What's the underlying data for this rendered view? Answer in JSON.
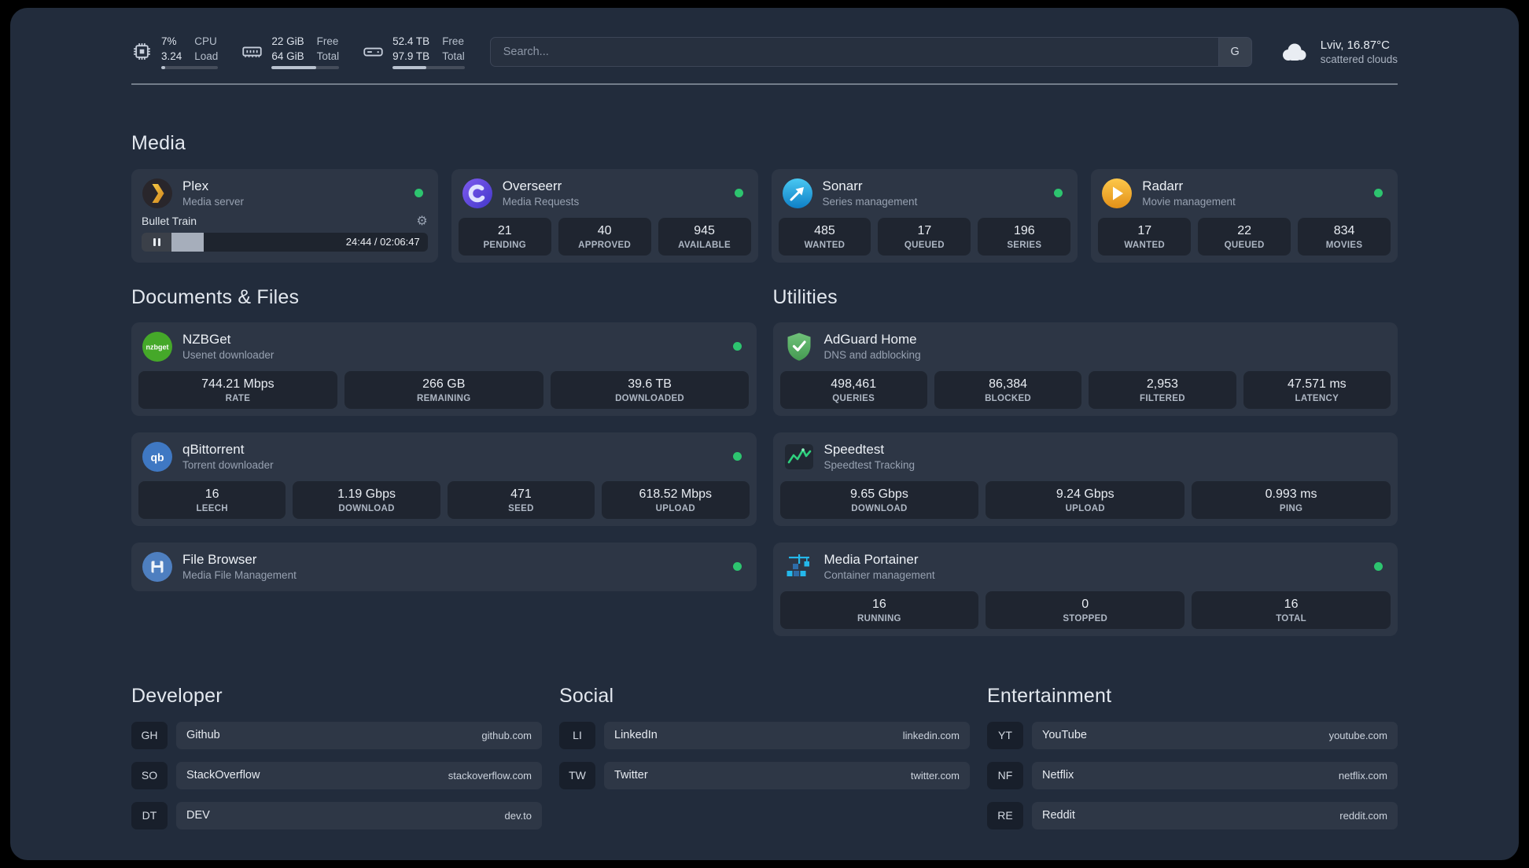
{
  "colors": {
    "status_online": "#2dc46f",
    "plex_gold": "#e5a00d",
    "overseerr_purple": "#6d4aef",
    "sonarr_blue": "#35c5f4",
    "radarr_amber": "#f7b731",
    "nzbget_green": "#45a829",
    "qbittorrent_blue": "#3f78c3",
    "filebrowser_blue": "#4e7fc0",
    "adguard_green": "#5bb462",
    "speedtest_green": "#2fd07e",
    "portainer_blue": "#24b8eb"
  },
  "icons": {
    "nzbget_text": "nzbget",
    "qbittorrent_text": "qb"
  },
  "topbar": {
    "resources": [
      {
        "value": "7%",
        "value2": "3.24",
        "label": "CPU",
        "label2": "Load",
        "progress_pct": 7
      },
      {
        "value": "22 GiB",
        "value2": "64 GiB",
        "label": "Free",
        "label2": "Total",
        "progress_pct": 66
      },
      {
        "value": "52.4 TB",
        "value2": "97.9 TB",
        "label": "Free",
        "label2": "Total",
        "progress_pct": 47
      }
    ],
    "search": {
      "placeholder": "Search...",
      "button": "G"
    },
    "weather": {
      "location": "Lviv, 16.87°C",
      "condition": "scattered clouds"
    }
  },
  "media": {
    "title": "Media",
    "plex": {
      "name": "Plex",
      "subtitle": "Media server",
      "player": {
        "title": "Bullet Train",
        "time": "24:44 / 02:06:47",
        "progress_pct": 19.5,
        "gear": "⚙"
      }
    },
    "overseerr": {
      "name": "Overseerr",
      "subtitle": "Media Requests",
      "stats": [
        {
          "value": "21",
          "label": "PENDING"
        },
        {
          "value": "40",
          "label": "APPROVED"
        },
        {
          "value": "945",
          "label": "AVAILABLE"
        }
      ]
    },
    "sonarr": {
      "name": "Sonarr",
      "subtitle": "Series management",
      "stats": [
        {
          "value": "485",
          "label": "WANTED"
        },
        {
          "value": "17",
          "label": "QUEUED"
        },
        {
          "value": "196",
          "label": "SERIES"
        }
      ]
    },
    "radarr": {
      "name": "Radarr",
      "subtitle": "Movie management",
      "stats": [
        {
          "value": "17",
          "label": "WANTED"
        },
        {
          "value": "22",
          "label": "QUEUED"
        },
        {
          "value": "834",
          "label": "MOVIES"
        }
      ]
    }
  },
  "documents": {
    "title": "Documents & Files",
    "nzbget": {
      "name": "NZBGet",
      "subtitle": "Usenet downloader",
      "stats": [
        {
          "value": "744.21 Mbps",
          "label": "RATE"
        },
        {
          "value": "266 GB",
          "label": "REMAINING"
        },
        {
          "value": "39.6 TB",
          "label": "DOWNLOADED"
        }
      ]
    },
    "qbittorrent": {
      "name": "qBittorrent",
      "subtitle": "Torrent downloader",
      "stats": [
        {
          "value": "16",
          "label": "LEECH"
        },
        {
          "value": "1.19 Gbps",
          "label": "DOWNLOAD"
        },
        {
          "value": "471",
          "label": "SEED"
        },
        {
          "value": "618.52 Mbps",
          "label": "UPLOAD"
        }
      ]
    },
    "filebrowser": {
      "name": "File Browser",
      "subtitle": "Media File Management"
    }
  },
  "utilities": {
    "title": "Utilities",
    "adguard": {
      "name": "AdGuard Home",
      "subtitle": "DNS and adblocking",
      "stats": [
        {
          "value": "498,461",
          "label": "QUERIES"
        },
        {
          "value": "86,384",
          "label": "BLOCKED"
        },
        {
          "value": "2,953",
          "label": "FILTERED"
        },
        {
          "value": "47.571 ms",
          "label": "LATENCY"
        }
      ]
    },
    "speedtest": {
      "name": "Speedtest",
      "subtitle": "Speedtest Tracking",
      "stats": [
        {
          "value": "9.65 Gbps",
          "label": "DOWNLOAD"
        },
        {
          "value": "9.24 Gbps",
          "label": "UPLOAD"
        },
        {
          "value": "0.993 ms",
          "label": "PING"
        }
      ]
    },
    "portainer": {
      "name": "Media Portainer",
      "subtitle": "Container management",
      "stats": [
        {
          "value": "16",
          "label": "RUNNING"
        },
        {
          "value": "0",
          "label": "STOPPED"
        },
        {
          "value": "16",
          "label": "TOTAL"
        }
      ]
    }
  },
  "bookmarks": {
    "developer": {
      "title": "Developer",
      "items": [
        {
          "abbr": "GH",
          "name": "Github",
          "url": "github.com"
        },
        {
          "abbr": "SO",
          "name": "StackOverflow",
          "url": "stackoverflow.com"
        },
        {
          "abbr": "DT",
          "name": "DEV",
          "url": "dev.to"
        }
      ]
    },
    "social": {
      "title": "Social",
      "items": [
        {
          "abbr": "LI",
          "name": "LinkedIn",
          "url": "linkedin.com"
        },
        {
          "abbr": "TW",
          "name": "Twitter",
          "url": "twitter.com"
        }
      ]
    },
    "entertainment": {
      "title": "Entertainment",
      "items": [
        {
          "abbr": "YT",
          "name": "YouTube",
          "url": "youtube.com"
        },
        {
          "abbr": "NF",
          "name": "Netflix",
          "url": "netflix.com"
        },
        {
          "abbr": "RE",
          "name": "Reddit",
          "url": "reddit.com"
        }
      ]
    }
  }
}
